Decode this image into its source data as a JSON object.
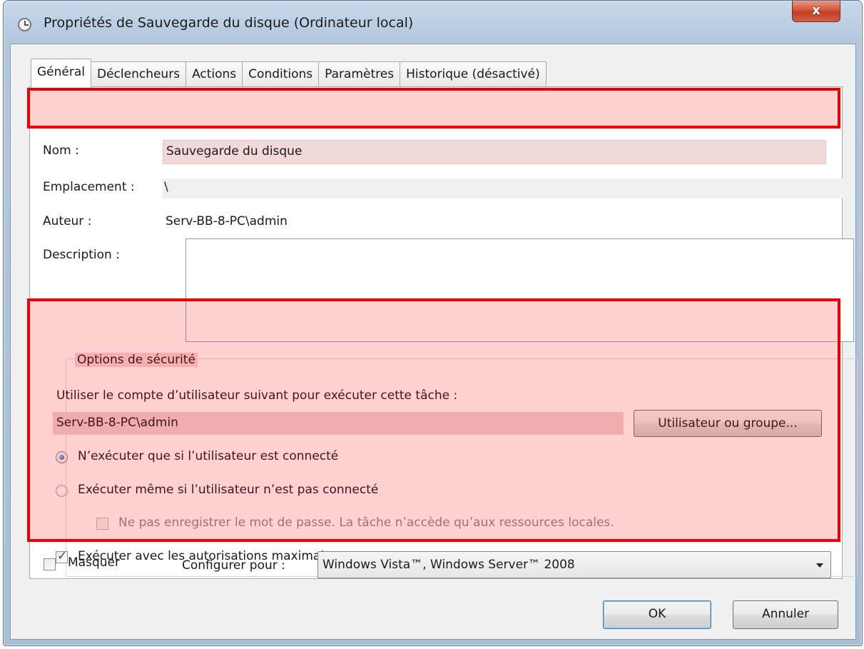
{
  "window": {
    "title": "Propriétés de Sauvegarde du disque (Ordinateur local)",
    "close_label": "x",
    "title_icon": "clock-icon"
  },
  "tabs": [
    {
      "label": "Général",
      "active": true
    },
    {
      "label": "Déclencheurs"
    },
    {
      "label": "Actions"
    },
    {
      "label": "Conditions"
    },
    {
      "label": "Paramètres"
    },
    {
      "label": "Historique (désactivé)"
    }
  ],
  "general": {
    "name_label": "Nom :",
    "name_value": "Sauvegarde du disque",
    "location_label": "Emplacement :",
    "location_value": "\\",
    "author_label": "Auteur :",
    "author_value": "Serv-BB-8-PC\\admin",
    "description_label": "Description :",
    "description_value": ""
  },
  "security": {
    "group_title": "Options de sécurité",
    "account_prompt": "Utiliser le compte d’utilisateur suivant pour exécuter cette tâche :",
    "account_value": "Serv-BB-8-PC\\admin",
    "user_group_button": "Utilisateur ou groupe...",
    "radio_logged_on": "N’exécuter que si l’utilisateur est connecté",
    "radio_logged_on_checked": true,
    "radio_any": "Exécuter même si l’utilisateur n’est pas connecté",
    "radio_any_checked": false,
    "no_store_password": "Ne pas enregistrer le mot de passe. La tâche n’accède qu’aux ressources locales.",
    "no_store_password_checked": false,
    "highest_privileges": "Exécuter avec les autorisations maximales",
    "highest_privileges_checked": true
  },
  "footer": {
    "hidden_label": "Masquer",
    "hidden_checked": false,
    "configure_label": "Configurer pour :",
    "configure_value": "Windows Vista™, Windows Server™ 2008",
    "ok_label": "OK",
    "cancel_label": "Annuler"
  },
  "colors": {
    "highlight_border": "#ee0000",
    "highlight_fill": "#ffd0d0",
    "window_frame": "#b3c8df",
    "close_button": "#c13d20"
  }
}
